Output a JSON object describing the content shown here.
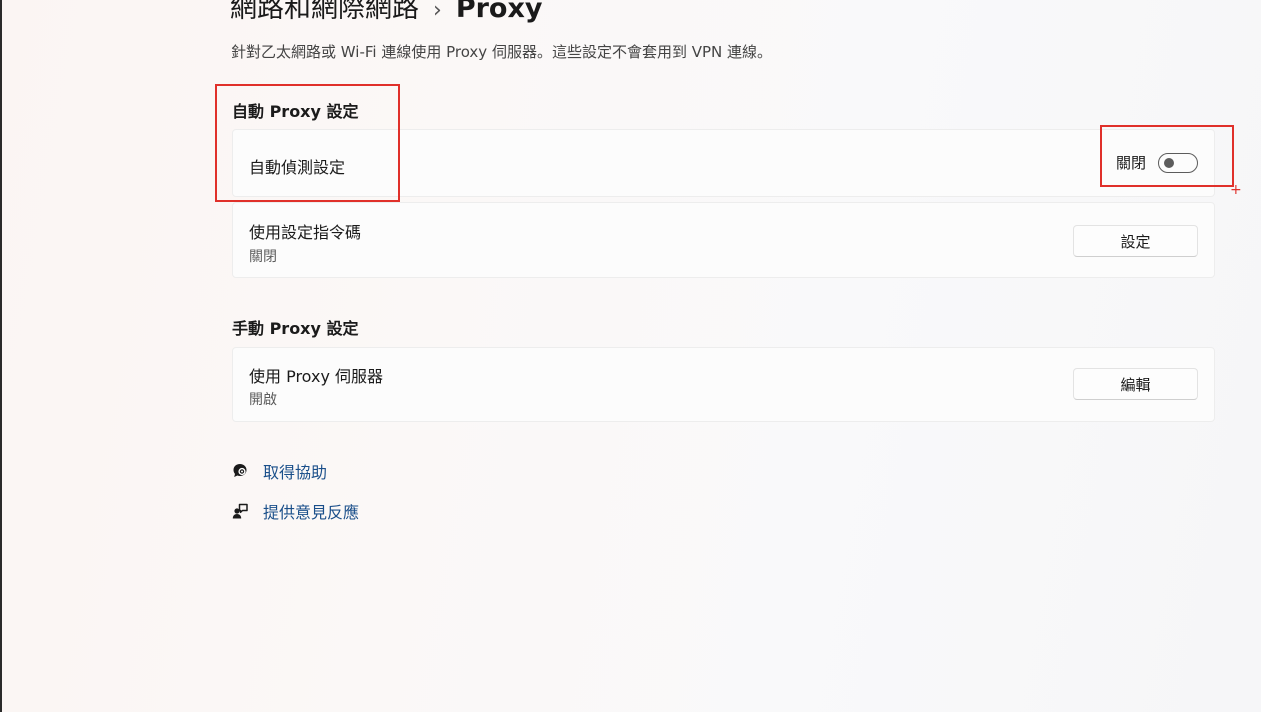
{
  "header": {
    "breadcrumb_parent": "網路和網際網路",
    "separator": "›",
    "current_page": "Proxy"
  },
  "description": "針對乙太網路或 Wi-Fi 連線使用 Proxy 伺服器。這些設定不會套用到 VPN 連線。",
  "auto_proxy": {
    "section_title": "自動 Proxy 設定",
    "auto_detect": {
      "label": "自動偵測設定",
      "state_text": "關閉",
      "enabled": false
    },
    "setup_script": {
      "label": "使用設定指令碼",
      "status": "關閉",
      "button_label": "設定"
    }
  },
  "manual_proxy": {
    "section_title": "手動 Proxy 設定",
    "use_proxy": {
      "label": "使用 Proxy 伺服器",
      "status": "開啟",
      "button_label": "編輯"
    }
  },
  "links": {
    "help": {
      "label": "取得協助",
      "icon": "help-chat-icon"
    },
    "feedback": {
      "label": "提供意見反應",
      "icon": "feedback-icon"
    }
  },
  "colors": {
    "annotation": "#e0302a",
    "link": "#1a4f8a",
    "toggle_off": "#5c5c5c"
  }
}
